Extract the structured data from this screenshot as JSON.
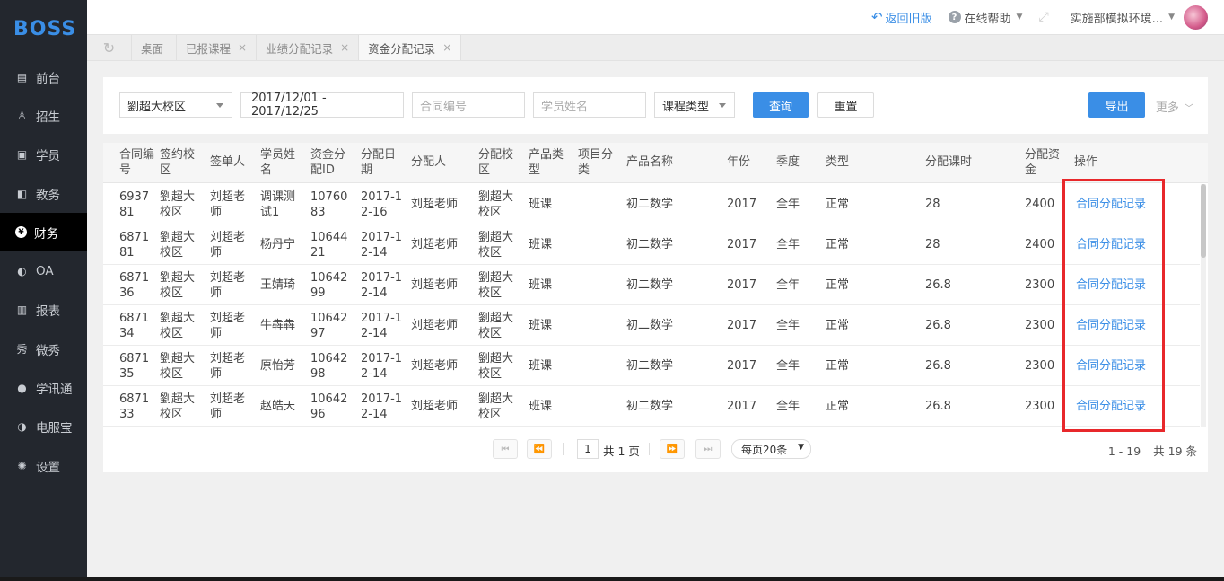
{
  "app": {
    "logo": "BOSS"
  },
  "sidebar": {
    "items": [
      {
        "label": "前台",
        "icon": "calendar-icon",
        "glyph": "▤"
      },
      {
        "label": "招生",
        "icon": "user-plus-icon",
        "glyph": "♙"
      },
      {
        "label": "学员",
        "icon": "student-card-icon",
        "glyph": "▣"
      },
      {
        "label": "教务",
        "icon": "book-icon",
        "glyph": "◧"
      },
      {
        "label": "财务",
        "icon": "yen-coin-icon",
        "glyph": "¥",
        "active": true
      },
      {
        "label": "OA",
        "icon": "toggle-icon",
        "glyph": "◐"
      },
      {
        "label": "报表",
        "icon": "bar-chart-icon",
        "glyph": "▥"
      },
      {
        "label": "微秀",
        "icon": "weixiu-icon",
        "glyph": "秀"
      },
      {
        "label": "学讯通",
        "icon": "location-pin-icon",
        "glyph": "●"
      },
      {
        "label": "电服宝",
        "icon": "phone-icon",
        "glyph": "◑"
      },
      {
        "label": "设置",
        "icon": "gear-icon",
        "glyph": "✺"
      }
    ]
  },
  "topbar": {
    "back_label": "返回旧版",
    "help_label": "在线帮助",
    "user_label": "实施部模拟环境..."
  },
  "tabs": [
    {
      "label": "桌面",
      "closable": false
    },
    {
      "label": "已报课程",
      "closable": true
    },
    {
      "label": "业绩分配记录",
      "closable": true
    },
    {
      "label": "资金分配记录",
      "closable": true,
      "active": true
    }
  ],
  "filter": {
    "campus": "劉超大校区",
    "date_range": "2017/12/01 - 2017/12/25",
    "contract_placeholder": "合同编号",
    "student_placeholder": "学员姓名",
    "course_type": "课程类型",
    "search_label": "查询",
    "reset_label": "重置",
    "export_label": "导出",
    "more_label": "更多"
  },
  "table": {
    "columns": [
      "合同编号",
      "签约校区",
      "签单人",
      "学员姓名",
      "资金分配ID",
      "分配日期",
      "分配人",
      "分配校区",
      "产品类型",
      "项目分类",
      "产品名称",
      "年份",
      "季度",
      "类型",
      "分配课时",
      "分配资金",
      "操作"
    ],
    "rows": [
      [
        "693781",
        "劉超大校区",
        "刘超老师",
        "调课测试1",
        "1076083",
        "2017-12-16",
        "刘超老师",
        "劉超大校区",
        "班课",
        "",
        "初二数学",
        "2017",
        "全年",
        "正常",
        "28",
        "2400",
        "合同分配记录"
      ],
      [
        "687181",
        "劉超大校区",
        "刘超老师",
        "杨丹宁",
        "1064421",
        "2017-12-14",
        "刘超老师",
        "劉超大校区",
        "班课",
        "",
        "初二数学",
        "2017",
        "全年",
        "正常",
        "28",
        "2400",
        "合同分配记录"
      ],
      [
        "687136",
        "劉超大校区",
        "刘超老师",
        "王婧琦",
        "1064299",
        "2017-12-14",
        "刘超老师",
        "劉超大校区",
        "班课",
        "",
        "初二数学",
        "2017",
        "全年",
        "正常",
        "26.8",
        "2300",
        "合同分配记录"
      ],
      [
        "687134",
        "劉超大校区",
        "刘超老师",
        "牛犇犇",
        "1064297",
        "2017-12-14",
        "刘超老师",
        "劉超大校区",
        "班课",
        "",
        "初二数学",
        "2017",
        "全年",
        "正常",
        "26.8",
        "2300",
        "合同分配记录"
      ],
      [
        "687135",
        "劉超大校区",
        "刘超老师",
        "原怡芳",
        "1064298",
        "2017-12-14",
        "刘超老师",
        "劉超大校区",
        "班课",
        "",
        "初二数学",
        "2017",
        "全年",
        "正常",
        "26.8",
        "2300",
        "合同分配记录"
      ],
      [
        "687133",
        "劉超大校区",
        "刘超老师",
        "赵皓天",
        "1064296",
        "2017-12-14",
        "刘超老师",
        "劉超大校区",
        "班课",
        "",
        "初二数学",
        "2017",
        "全年",
        "正常",
        "26.8",
        "2300",
        "合同分配记录"
      ]
    ]
  },
  "pagination": {
    "current_page": "1",
    "total_pages_label": "共 1 页",
    "page_size_label": "每页20条",
    "range_label": "1 - 19",
    "total_label": "共 19 条"
  },
  "colors": {
    "accent": "#3a8ee6",
    "sidebar": "#23272e",
    "highlight": "#e8282b"
  }
}
